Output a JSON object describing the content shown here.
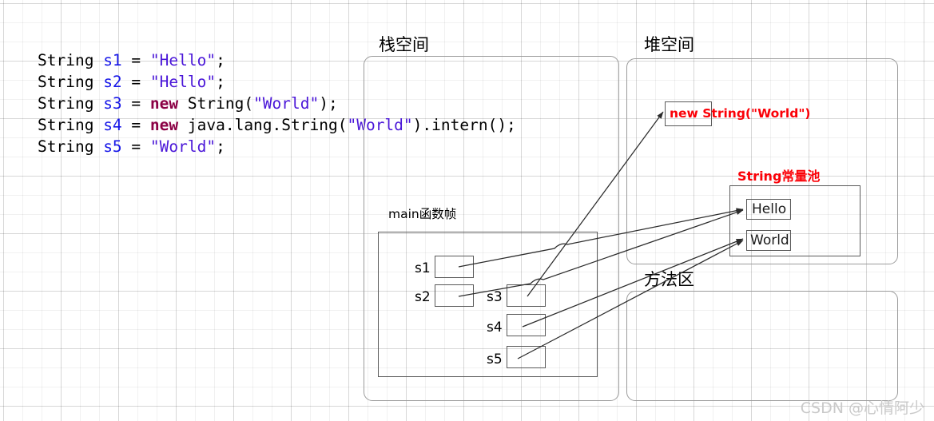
{
  "code": {
    "lines": [
      {
        "tokens": [
          {
            "t": "String ",
            "c": "plain"
          },
          {
            "t": "s1",
            "c": "var"
          },
          {
            "t": " = ",
            "c": "plain"
          },
          {
            "t": "\"Hello\"",
            "c": "str"
          },
          {
            "t": ";",
            "c": "plain"
          }
        ]
      },
      {
        "tokens": [
          {
            "t": "String ",
            "c": "plain"
          },
          {
            "t": "s2",
            "c": "var"
          },
          {
            "t": " = ",
            "c": "plain"
          },
          {
            "t": "\"Hello\"",
            "c": "str"
          },
          {
            "t": ";",
            "c": "plain"
          }
        ]
      },
      {
        "tokens": [
          {
            "t": "String ",
            "c": "plain"
          },
          {
            "t": "s3",
            "c": "var"
          },
          {
            "t": " = ",
            "c": "plain"
          },
          {
            "t": "new",
            "c": "kw"
          },
          {
            "t": " String(",
            "c": "plain"
          },
          {
            "t": "\"World\"",
            "c": "str"
          },
          {
            "t": ");",
            "c": "plain"
          }
        ]
      },
      {
        "tokens": [
          {
            "t": "String ",
            "c": "plain"
          },
          {
            "t": "s4",
            "c": "var"
          },
          {
            "t": " = ",
            "c": "plain"
          },
          {
            "t": "new",
            "c": "kw"
          },
          {
            "t": " java.lang.String(",
            "c": "plain"
          },
          {
            "t": "\"World\"",
            "c": "str"
          },
          {
            "t": ").intern();",
            "c": "plain"
          }
        ]
      },
      {
        "tokens": [
          {
            "t": "String ",
            "c": "plain"
          },
          {
            "t": "s5",
            "c": "var"
          },
          {
            "t": " = ",
            "c": "plain"
          },
          {
            "t": "\"World\"",
            "c": "str"
          },
          {
            "t": ";",
            "c": "plain"
          }
        ]
      }
    ]
  },
  "regions": {
    "stack": {
      "title": "栈空间"
    },
    "heap": {
      "title": "堆空间"
    },
    "method_area": {
      "title": "方法区"
    }
  },
  "stack": {
    "frame_title": "main函数帧",
    "variables": [
      {
        "name": "s1"
      },
      {
        "name": "s2"
      },
      {
        "name": "s3"
      },
      {
        "name": "s4"
      },
      {
        "name": "s5"
      }
    ]
  },
  "heap": {
    "object_label": "new String(\"World\")",
    "pool_title": "String常量池",
    "pool_entries": [
      {
        "value": "Hello"
      },
      {
        "value": "World"
      }
    ]
  },
  "watermark": {
    "text": "CSDN @心情阿少"
  },
  "colors": {
    "code_keyword": "#8b0045",
    "code_variable": "#1616e8",
    "code_string": "#4a16d8",
    "annotation_red": "#fb0007",
    "region_border": "#9b9b9b",
    "box_border": "#5a5a5a",
    "grid": "#e3e3e3"
  }
}
